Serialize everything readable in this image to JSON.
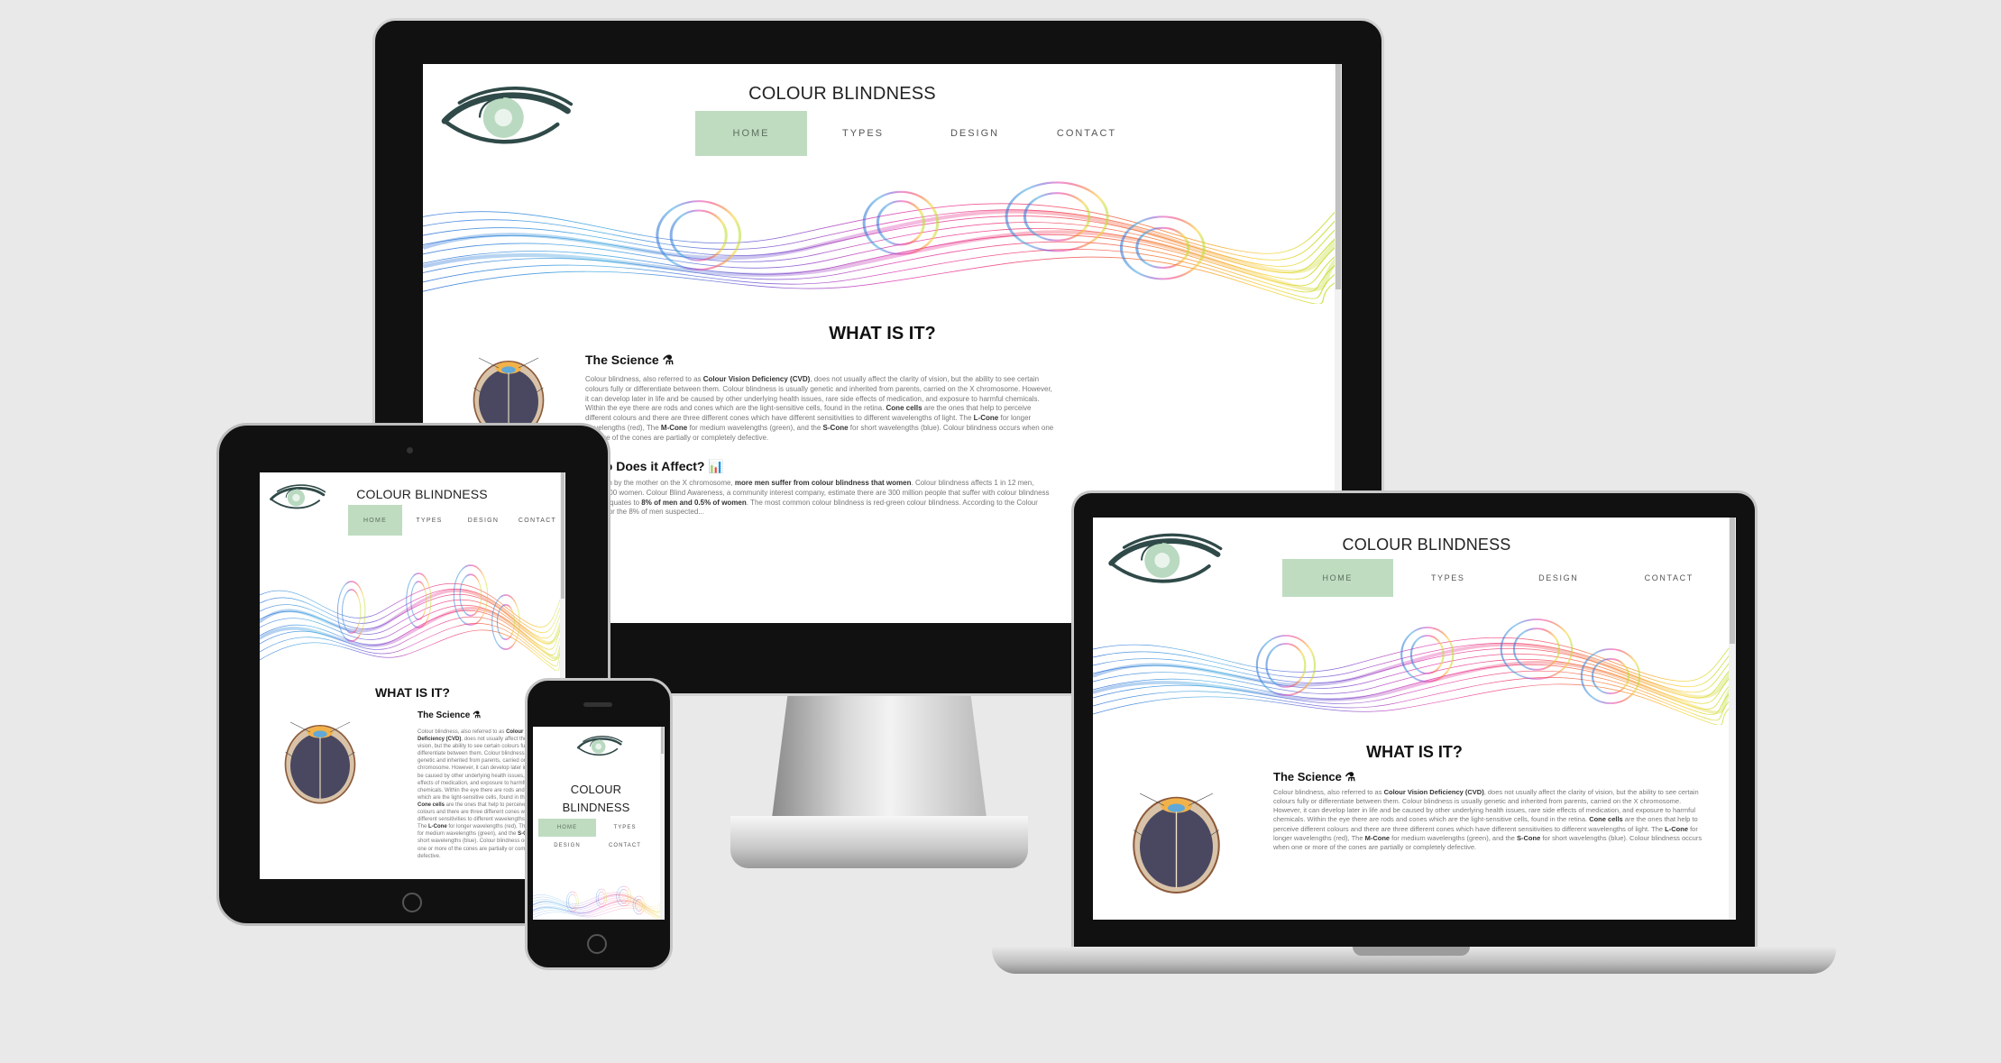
{
  "site": {
    "brand": "COLOUR BLINDNESS",
    "brand_mobile_line1": "COLOUR",
    "brand_mobile_line2": "BLINDNESS",
    "nav": [
      "HOME",
      "TYPES",
      "DESIGN",
      "CONTACT"
    ],
    "active_nav": "HOME",
    "section_title": "WHAT IS IT?",
    "science_title": "The Science ⚗",
    "science_text_1": "Colour blindness, also referred to as ",
    "science_bold_1": "Colour Vision Deficiency (CVD)",
    "science_text_2": ", does not usually affect the clarity of vision, but the ability to see certain colours fully or differentiate between them. Colour blindness is usually genetic and inherited from parents, carried on the X chromosome. However, it can develop later in life and be caused by other underlying health issues, rare side effects of medication, and exposure to harmful chemicals. Within the eye there are rods and cones which are the light-sensitive cells, found in the retina. ",
    "science_bold_2": "Cone cells",
    "science_text_3": " are the ones that help to perceive different colours and there are three different cones which have different sensitivities to different wavelengths of light. The ",
    "science_bold_3": "L-Cone",
    "science_text_4": " for longer wavelengths (red), The ",
    "science_bold_4": "M-Cone",
    "science_text_5": " for medium wavelengths (green), and the ",
    "science_bold_5": "S-Cone",
    "science_text_6": " for short wavelengths (blue). Colour blindness occurs when one or more of the cones are partially or completely defective.",
    "affect_title": "Who Does it Affect? 📊",
    "affect_text_1": "Being passed down by the mother on the X chromosome, ",
    "affect_bold_1": "more men suffer from colour blindness that women",
    "affect_text_2": ". Colour blindness affects 1 in 12 men, compared to 1 in 200 women. Colour Blind Awareness, a community interest company, estimate there are 300 million people that suffer with colour blindness worldwide, which equates to ",
    "affect_bold_2": "8% of men and 0.5% of women",
    "affect_text_3": ". The most common colour blindness is red-green colour blindness. According to the Colour Blind Awareness, for the 8% of men suspected..."
  },
  "colors": {
    "background": "#e9e9e9",
    "nav_active": "#bfdcc1",
    "eye_dark": "#2f4a48",
    "eye_iris": "#b9d9c0"
  },
  "icons": {
    "logo": "eye-logo",
    "science": "flask-icon",
    "affect": "bar-chart-icon"
  }
}
